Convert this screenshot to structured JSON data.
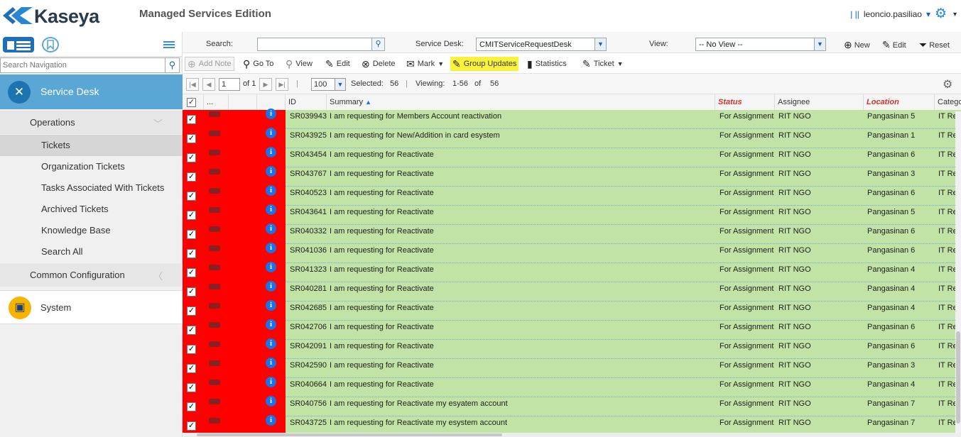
{
  "brand": {
    "name": "Kaseya",
    "edition": "Managed Services Edition",
    "accent": "#1e88e5"
  },
  "user": {
    "name": "leoncio.pasiliao",
    "separator": "| ||"
  },
  "sidebar": {
    "search_placeholder": "Search Navigation",
    "module": "Service Desk",
    "groups": [
      {
        "label": "Operations",
        "items": [
          "Tickets",
          "Organization Tickets",
          "Tasks Associated With Tickets",
          "Archived Tickets",
          "Knowledge Base",
          "Search All"
        ]
      },
      {
        "label": "Common Configuration"
      }
    ],
    "active_item": "Tickets",
    "system": "System"
  },
  "filter": {
    "search_label": "Search:",
    "search_value": "",
    "desk_label": "Service Desk:",
    "desk_value": "CMITServiceRequestDesk",
    "view_label": "View:",
    "view_value": "-- No View --",
    "new_label": "New",
    "edit_label": "Edit",
    "reset_label": "Reset"
  },
  "actions": {
    "add_note": "Add Note",
    "go_to": "Go To",
    "view": "View",
    "edit": "Edit",
    "delete": "Delete",
    "mark": "Mark",
    "group_updates": "Group Updates",
    "statistics": "Statistics",
    "ticket": "Ticket"
  },
  "pager": {
    "page": "1",
    "of": "of 1",
    "page_size": "100",
    "selected_label": "Selected:",
    "selected": "56",
    "viewing_label": "Viewing:",
    "viewing": "1-56",
    "of_label": "of",
    "total": "56"
  },
  "grid": {
    "headers": {
      "dots": "...",
      "id": "ID",
      "summary": "Summary",
      "status": "Status",
      "assignee": "Assignee",
      "location": "Location",
      "category": "Catego"
    },
    "rows": [
      {
        "id": "SR039943",
        "summary": "I am requesting for Members Account reactivation",
        "status": "For Assignment",
        "assignee": "RIT NGO",
        "location": "Pangasinan 5",
        "category": "IT Re"
      },
      {
        "id": "SR043925",
        "summary": "I am requesting for New/Addition in card esystem",
        "status": "For Assignment",
        "assignee": "RIT NGO",
        "location": "Pangasinan 1",
        "category": "IT Re"
      },
      {
        "id": "SR043454",
        "summary": "I am requesting for Reactivate",
        "status": "For Assignment",
        "assignee": "RIT NGO",
        "location": "Pangasinan 6",
        "category": "IT Re"
      },
      {
        "id": "SR043767",
        "summary": "I am requesting for Reactivate",
        "status": "For Assignment",
        "assignee": "RIT NGO",
        "location": "Pangasinan 3",
        "category": "IT Re"
      },
      {
        "id": "SR040523",
        "summary": "I am requesting for Reactivate",
        "status": "For Assignment",
        "assignee": "RIT NGO",
        "location": "Pangasinan 6",
        "category": "IT Re"
      },
      {
        "id": "SR043641",
        "summary": "I am requesting for Reactivate",
        "status": "For Assignment",
        "assignee": "RIT NGO",
        "location": "Pangasinan 5",
        "category": "IT Re"
      },
      {
        "id": "SR040332",
        "summary": "I am requesting for Reactivate",
        "status": "For Assignment",
        "assignee": "RIT NGO",
        "location": "Pangasinan 6",
        "category": "IT Re"
      },
      {
        "id": "SR041036",
        "summary": "I am requesting for Reactivate",
        "status": "For Assignment",
        "assignee": "RIT NGO",
        "location": "Pangasinan 6",
        "category": "IT Re"
      },
      {
        "id": "SR041323",
        "summary": "I am requesting for Reactivate",
        "status": "For Assignment",
        "assignee": "RIT NGO",
        "location": "Pangasinan 4",
        "category": "IT Re"
      },
      {
        "id": "SR040281",
        "summary": "I am requesting for Reactivate",
        "status": "For Assignment",
        "assignee": "RIT NGO",
        "location": "Pangasinan 4",
        "category": "IT Re"
      },
      {
        "id": "SR042685",
        "summary": "I am requesting for Reactivate",
        "status": "For Assignment",
        "assignee": "RIT NGO",
        "location": "Pangasinan 4",
        "category": "IT Re"
      },
      {
        "id": "SR042706",
        "summary": "I am requesting for Reactivate",
        "status": "For Assignment",
        "assignee": "RIT NGO",
        "location": "Pangasinan 6",
        "category": "IT Re"
      },
      {
        "id": "SR042091",
        "summary": "I am requesting for Reactivate",
        "status": "For Assignment",
        "assignee": "RIT NGO",
        "location": "Pangasinan 6",
        "category": "IT Re"
      },
      {
        "id": "SR042590",
        "summary": "I am requesting for Reactivate",
        "status": "For Assignment",
        "assignee": "RIT NGO",
        "location": "Pangasinan 3",
        "category": "IT Re"
      },
      {
        "id": "SR040664",
        "summary": "I am requesting for Reactivate",
        "status": "For Assignment",
        "assignee": "RIT NGO",
        "location": "Pangasinan 4",
        "category": "IT Re"
      },
      {
        "id": "SR040756",
        "summary": "I am requesting for Reactivate my esyatem account",
        "status": "For Assignment",
        "assignee": "RIT NGO",
        "location": "Pangasinan 7",
        "category": "IT Re"
      },
      {
        "id": "SR043725",
        "summary": "I am requesting for Reactivate my esystem account",
        "status": "For Assignment",
        "assignee": "RIT NGO",
        "location": "Pangasinan 7",
        "category": "IT Re"
      }
    ]
  }
}
